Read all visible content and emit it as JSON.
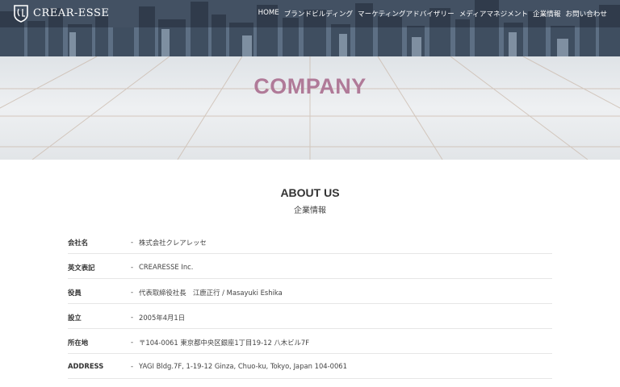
{
  "brand": {
    "name": "CREAR-ESSE"
  },
  "nav": {
    "items": [
      "HOME",
      "ブランドビルディング",
      "マーケティングアドバイザリー",
      "メディアマネジメント",
      "企業情報",
      "お問い合わせ"
    ]
  },
  "hero": {
    "title": "COMPANY"
  },
  "section": {
    "title": "ABOUT US",
    "subtitle": "企業情報"
  },
  "company": {
    "separator": "-",
    "rows": [
      {
        "label": "会社名",
        "value": "株式会社クレアレッセ"
      },
      {
        "label": "英文表記",
        "value": "CREARESSE Inc."
      },
      {
        "label": "役員",
        "value": "代表取締役社長　江鹿正行 / Masayuki Eshika"
      },
      {
        "label": "設立",
        "value": "2005年4月1日"
      },
      {
        "label": "所在地",
        "value": "〒104-0061 東京都中央区銀座1丁目19-12 八木ビル7F"
      },
      {
        "label": "ADDRESS",
        "value": "YAGI Bldg.7F, 1-19-12 Ginza, Chuo-ku, Tokyo, Japan 104-0061"
      }
    ]
  },
  "colors": {
    "title_accent": "#b07a98",
    "nav_text": "#ffffff"
  }
}
